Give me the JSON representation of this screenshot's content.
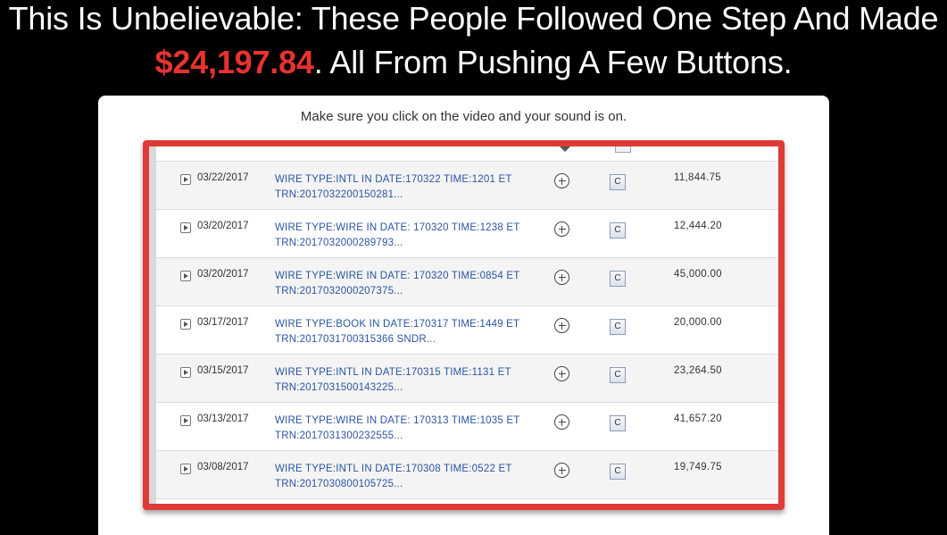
{
  "headline": {
    "line1": "This Is Unbelievable: These People Followed One Step And Made",
    "amount": "$24,197.84",
    "line2_rest": ". All From Pushing A Few Buttons."
  },
  "notice": "Make sure you click on the video and your sound is on.",
  "colors": {
    "background": "#000000",
    "accent_red": "#e03a36",
    "link_blue": "#2b55a3"
  },
  "transactions": [
    {
      "date": "03/22/2017",
      "desc_line1": "WIRE TYPE:INTL IN DATE:170322 TIME:1201 ET",
      "desc_line2": "TRN:201703220015028​1...",
      "amount": "11,844.75"
    },
    {
      "date": "03/20/2017",
      "desc_line1": "WIRE TYPE:WIRE IN DATE: 170320 TIME:1238 ET",
      "desc_line2": "TRN:201703200028979​3...",
      "amount": "12,444.20"
    },
    {
      "date": "03/20/2017",
      "desc_line1": "WIRE TYPE:WIRE IN DATE: 170320 TIME:0854 ET",
      "desc_line2": "TRN:201703200020737​5...",
      "amount": "45,000.00"
    },
    {
      "date": "03/17/2017",
      "desc_line1": "WIRE TYPE:BOOK IN DATE:170317 TIME:1449 ET",
      "desc_line2": "TRN:2017031700315366 SNDR...",
      "amount": "20,000.00"
    },
    {
      "date": "03/15/2017",
      "desc_line1": "WIRE TYPE:INTL IN DATE:170315 TIME:1131 ET",
      "desc_line2": "TRN:201703150014322​5...",
      "amount": "23,264.50"
    },
    {
      "date": "03/13/2017",
      "desc_line1": "WIRE TYPE:WIRE IN DATE: 170313 TIME:1035 ET",
      "desc_line2": "TRN:201703130023255​5...",
      "amount": "41,657.20"
    },
    {
      "date": "03/08/2017",
      "desc_line1": "WIRE TYPE:INTL IN DATE:170308 TIME:0522 ET",
      "desc_line2": "TRN:201703080010572​5...",
      "amount": "19,749.75"
    }
  ],
  "icons": {
    "expand": "play-triangle-icon",
    "add": "plus-circle-icon",
    "check_image": "c-button-icon"
  }
}
